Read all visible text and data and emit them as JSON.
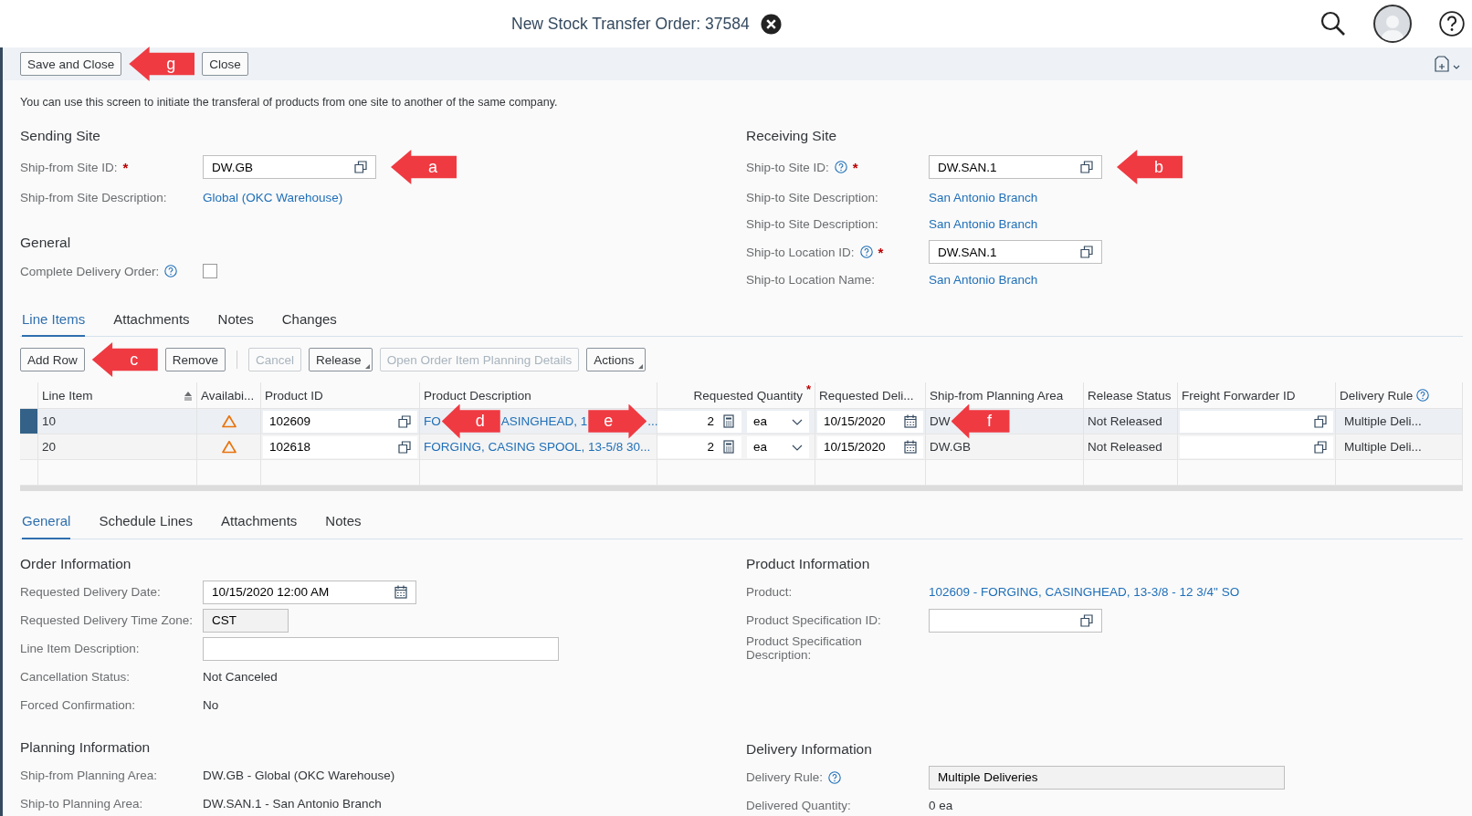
{
  "header": {
    "title": "New Stock Transfer Order: 37584"
  },
  "toolbar": {
    "items": [
      {
        "kind": "button",
        "label": "Save and Close"
      },
      {
        "kind": "left_callout",
        "label": "g"
      },
      {
        "kind": "button",
        "label": "Close"
      }
    ]
  },
  "intro": "You can use this screen to initiate the transferal of products from one site to another of the same company.",
  "sending_site": {
    "title": "Sending Site",
    "fields": [
      {
        "label": "Ship-from Site ID:",
        "kind": "value_help",
        "value": "DW.GB",
        "required_mark": "*",
        "callout": {
          "label": "a",
          "kind": "left"
        }
      },
      {
        "label": "Ship-from Site Description:",
        "kind": "link",
        "value": "Global (OKC Warehouse)"
      }
    ]
  },
  "general": {
    "title": "General",
    "fields": [
      {
        "label": "Complete Delivery Order:",
        "kind": "checkbox",
        "help": true,
        "checked": false
      }
    ]
  },
  "receiving_site": {
    "title": "Receiving Site",
    "fields": [
      {
        "label": "Ship-to Site ID:",
        "kind": "value_help",
        "value": "DW.SAN.1",
        "help": true,
        "required_mark": "*",
        "callout": {
          "label": "b",
          "kind": "left"
        }
      },
      {
        "label": "Ship-to Site Description:",
        "kind": "link",
        "value": "San Antonio Branch"
      },
      {
        "label": "Ship-to Site Description:",
        "kind": "link",
        "value": "San Antonio Branch"
      },
      {
        "label": "Ship-to Location ID:",
        "kind": "value_help",
        "value": "DW.SAN.1",
        "help": true,
        "required_mark": "*"
      },
      {
        "label": "Ship-to Location Name:",
        "kind": "link",
        "value": "San Antonio Branch"
      }
    ]
  },
  "tabs": [
    {
      "label": "Line Items",
      "selected": true
    },
    {
      "label": "Attachments",
      "selected": false
    },
    {
      "label": "Notes",
      "selected": false
    },
    {
      "label": "Changes",
      "selected": false
    }
  ],
  "line_toolbar": {
    "items": [
      {
        "kind": "button",
        "label": "Add Row",
        "disabled": false
      },
      {
        "kind": "left_callout",
        "label": "c"
      },
      {
        "kind": "button",
        "label": "Remove",
        "disabled": false
      },
      {
        "kind": "separator"
      },
      {
        "kind": "button",
        "label": "Cancel",
        "disabled": true
      },
      {
        "kind": "menu",
        "label": "Release",
        "disabled": false
      },
      {
        "kind": "button",
        "label": "Open Order Item Planning Details",
        "disabled": true
      },
      {
        "kind": "menu",
        "label": "Actions",
        "disabled": false
      }
    ]
  },
  "table": {
    "columns": [
      {
        "label": "Line Item",
        "sort": true
      },
      {
        "label": "Availabi..."
      },
      {
        "label": "Product ID"
      },
      {
        "label": "Product Description"
      },
      {
        "label": "Requested Quantity",
        "required_mark": "*"
      },
      {
        "label": "Requested Deli..."
      },
      {
        "label": "Ship-from Planning Area"
      },
      {
        "label": "Release Status"
      },
      {
        "label": "Freight Forwarder ID"
      },
      {
        "label": "Delivery Rule",
        "help": true
      }
    ],
    "rows": [
      {
        "selected": true,
        "line_item": "10",
        "warning": true,
        "product_id": "102609",
        "product_description": [
          {
            "text": "FO"
          },
          {
            "callout": {
              "label": "d",
              "kind": "left"
            }
          },
          {
            "text": "ASINGHEAD, 1"
          },
          {
            "callout": {
              "label": "e",
              "kind": "right"
            }
          },
          {
            "text": "..."
          }
        ],
        "quantity": "2",
        "unit": "ea",
        "requested_delivery": "10/15/2020",
        "ship_from_planning_area": [
          {
            "text": "DW"
          },
          {
            "callout": {
              "label": "f",
              "kind": "left"
            }
          }
        ],
        "release_status": "Not Released",
        "delivery_rule": "Multiple Deli..."
      },
      {
        "selected": false,
        "line_item": "20",
        "warning": true,
        "product_id": "102618",
        "product_description": [
          {
            "text": "FORGING, CASING SPOOL, 13-5/8 30..."
          }
        ],
        "quantity": "2",
        "unit": "ea",
        "requested_delivery": "10/15/2020",
        "ship_from_planning_area": [
          {
            "text": "DW.GB"
          }
        ],
        "release_status": "Not Released",
        "delivery_rule": "Multiple Deli..."
      }
    ]
  },
  "detail_tabs": [
    {
      "label": "General",
      "selected": true
    },
    {
      "label": "Schedule Lines",
      "selected": false
    },
    {
      "label": "Attachments",
      "selected": false
    },
    {
      "label": "Notes",
      "selected": false
    }
  ],
  "order_information": {
    "title": "Order Information",
    "fields": [
      {
        "label": "Requested Delivery Date:",
        "kind": "date",
        "value": "10/15/2020 12:00 AM"
      },
      {
        "label": "Requested Delivery Time Zone:",
        "kind": "display",
        "value": "CST"
      },
      {
        "label": "Line Item Description:",
        "kind": "input"
      },
      {
        "label": "Cancellation Status:",
        "kind": "text",
        "value": "Not Canceled"
      },
      {
        "label": "Forced Confirmation:",
        "kind": "text",
        "value": "No"
      }
    ]
  },
  "planning_information": {
    "title": "Planning Information",
    "fields": [
      {
        "label": "Ship-from Planning Area:",
        "kind": "text",
        "value": "DW.GB - Global (OKC Warehouse)"
      },
      {
        "label": "Ship-to Planning Area:",
        "kind": "text",
        "value": "DW.SAN.1 - San Antonio Branch"
      }
    ]
  },
  "product_information": {
    "title": "Product Information",
    "fields": [
      {
        "label": "Product:",
        "kind": "link",
        "value": "102609 - FORGING, CASINGHEAD, 13-3/8 - 12 3/4\" SO"
      },
      {
        "label": "Product Specification ID:",
        "kind": "value_help"
      },
      {
        "label": "Product Specification Description:",
        "kind": "text"
      }
    ]
  },
  "delivery_information": {
    "title": "Delivery Information",
    "fields": [
      {
        "label": "Delivery Rule:",
        "kind": "display_wide",
        "value": "Multiple Deliveries",
        "help": true
      },
      {
        "label": "Delivered Quantity:",
        "kind": "text",
        "value": "0 ea"
      }
    ]
  }
}
